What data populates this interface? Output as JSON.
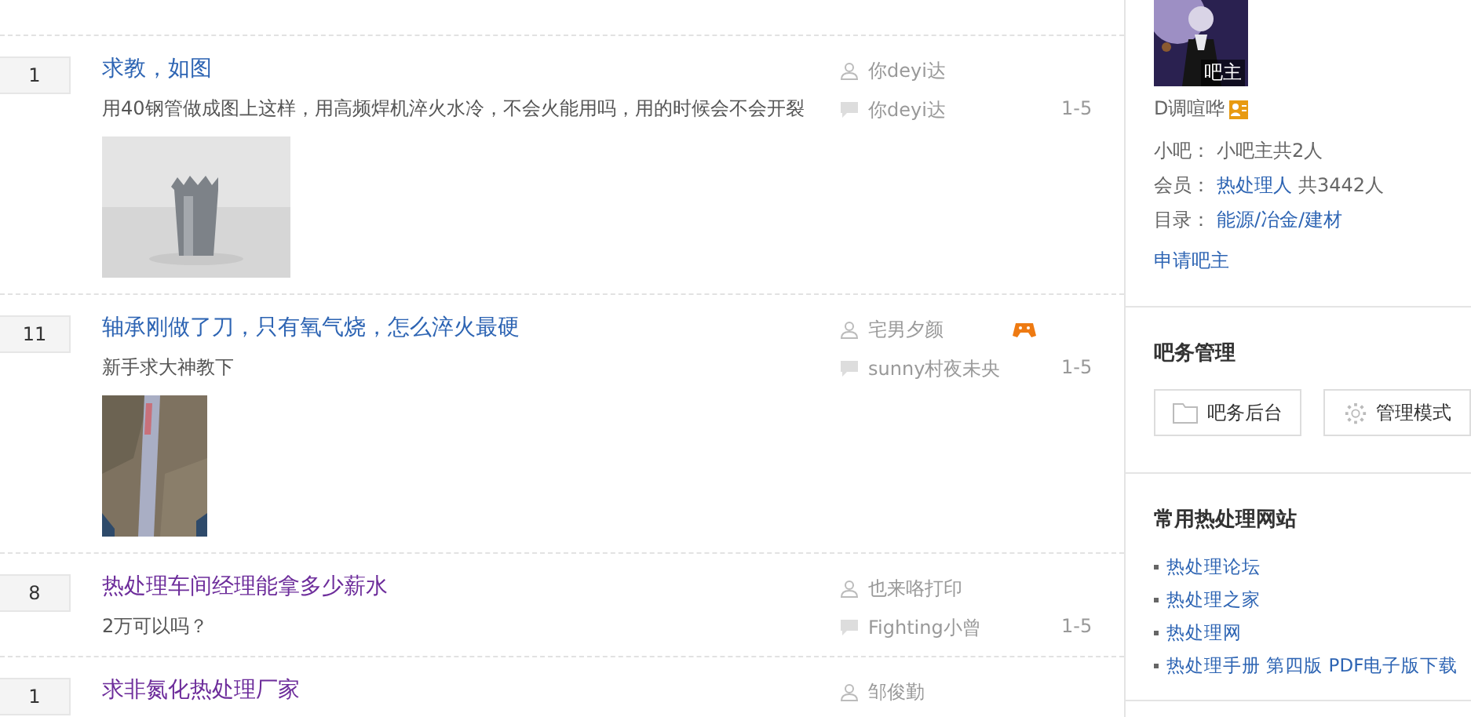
{
  "threads": [
    {
      "replies": "1",
      "title": "求教，如图",
      "visited": false,
      "abstract": "用40钢管做成图上这样，用高频焊机淬火水冷，不会火能用吗，用的时候会不会开裂",
      "author": "你deyi达",
      "author_badge": false,
      "last_reply": "你deyi达",
      "time": "1-5"
    },
    {
      "replies": "11",
      "title": "轴承刚做了刀，只有氧气烧，怎么淬火最硬",
      "visited": false,
      "abstract": "新手求大神教下",
      "author": "宅男夕颜",
      "author_badge": true,
      "last_reply": "sunny村夜未央",
      "time": "1-5"
    },
    {
      "replies": "8",
      "title": "热处理车间经理能拿多少薪水",
      "visited": true,
      "abstract": "2万可以吗？",
      "author": "也来咯打印",
      "author_badge": false,
      "last_reply": "Fighting小曾",
      "time": "1-5"
    },
    {
      "replies": "1",
      "title": "求非氮化热处理厂家",
      "visited": true,
      "author": "邹俊勤",
      "author_badge": false
    }
  ],
  "sidebar": {
    "avatar_label": "吧主",
    "owner_name": "D调喧哗",
    "info": [
      {
        "label": "小吧：",
        "text": "小吧主共2人"
      },
      {
        "label": "会员：",
        "link": "热处理人",
        "text": "共3442人"
      },
      {
        "label": "目录：",
        "link": "能源/冶金/建材"
      }
    ],
    "apply_link": "申请吧主",
    "admin_title": "吧务管理",
    "admin_buttons": [
      {
        "kind": "folder",
        "label": "吧务后台"
      },
      {
        "kind": "gear",
        "label": "管理模式"
      }
    ],
    "sites_title": "常用热处理网站",
    "sites": [
      "热处理论坛",
      "热处理之家",
      "热处理网",
      "热处理手册 第四版 PDF电子版下载"
    ]
  }
}
